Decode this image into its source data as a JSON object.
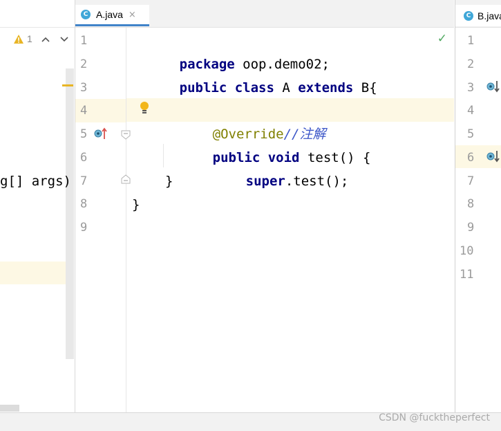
{
  "left_panel": {
    "warning_count": "1",
    "code_fragment": "g[] args)"
  },
  "center_editor": {
    "tab_label": "A.java",
    "tab_close": "×",
    "tab_icon_letter": "C",
    "status_check": "✓",
    "lines": [
      {
        "n": "1",
        "text": "package oop.demo02;"
      },
      {
        "n": "2",
        "text": "public class A extends B{"
      },
      {
        "n": "3",
        "text": ""
      },
      {
        "n": "4",
        "annotation": "@Override",
        "comment": "//注解"
      },
      {
        "n": "5",
        "text": "public void test() {"
      },
      {
        "n": "6",
        "super": "super",
        "rest": ".test();"
      },
      {
        "n": "7",
        "text": "}"
      },
      {
        "n": "8",
        "text": "}"
      },
      {
        "n": "9",
        "text": ""
      }
    ],
    "keywords": {
      "package": "package",
      "public": "public",
      "class": "class",
      "extends": "extends",
      "void": "void"
    }
  },
  "right_editor": {
    "tab_label": "B.java",
    "tab_icon_letter": "C",
    "line_numbers": [
      "1",
      "2",
      "3",
      "4",
      "5",
      "6",
      "7",
      "8",
      "9",
      "10",
      "11"
    ]
  },
  "watermark": "CSDN @fucktheperfect",
  "colors": {
    "keyword": "#000080",
    "annotation": "#808000",
    "comment": "#3d57c8",
    "highlight_line": "#fdf8e4",
    "tab_underline": "#4083c9",
    "check_green": "#4fa860"
  }
}
